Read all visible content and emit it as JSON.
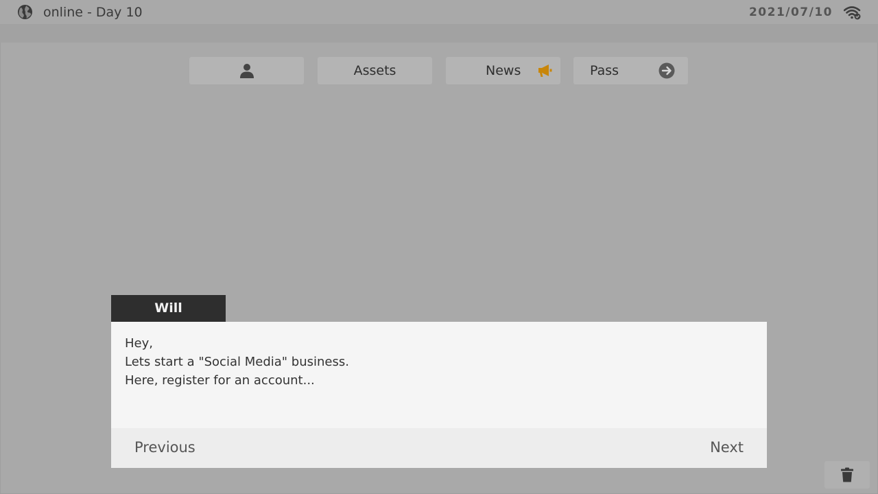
{
  "status_bar": {
    "title": "online - Day 10",
    "date": "2021/07/10",
    "globe_icon": "globe-icon",
    "wifi_icon": "wifi-icon"
  },
  "nav": {
    "profile": {
      "icon": "person-icon"
    },
    "assets": {
      "label": "Assets"
    },
    "news": {
      "label": "News",
      "icon": "megaphone-icon"
    },
    "pass": {
      "label": "Pass",
      "icon": "arrow-right-circle-icon"
    }
  },
  "dialog": {
    "speaker": "Will",
    "lines": [
      "Hey,",
      "Lets start a \"Social Media\" business.",
      "Here, register for an account..."
    ],
    "previous_label": "Previous",
    "next_label": "Next"
  },
  "trash": {
    "icon": "trash-icon"
  },
  "colors": {
    "background": "#a9a9a9",
    "nav_button": "#b4b4b4",
    "speaker_tab": "#2e2e2e",
    "dialog_body": "#f5f5f5",
    "news_accent": "#c8860a"
  }
}
